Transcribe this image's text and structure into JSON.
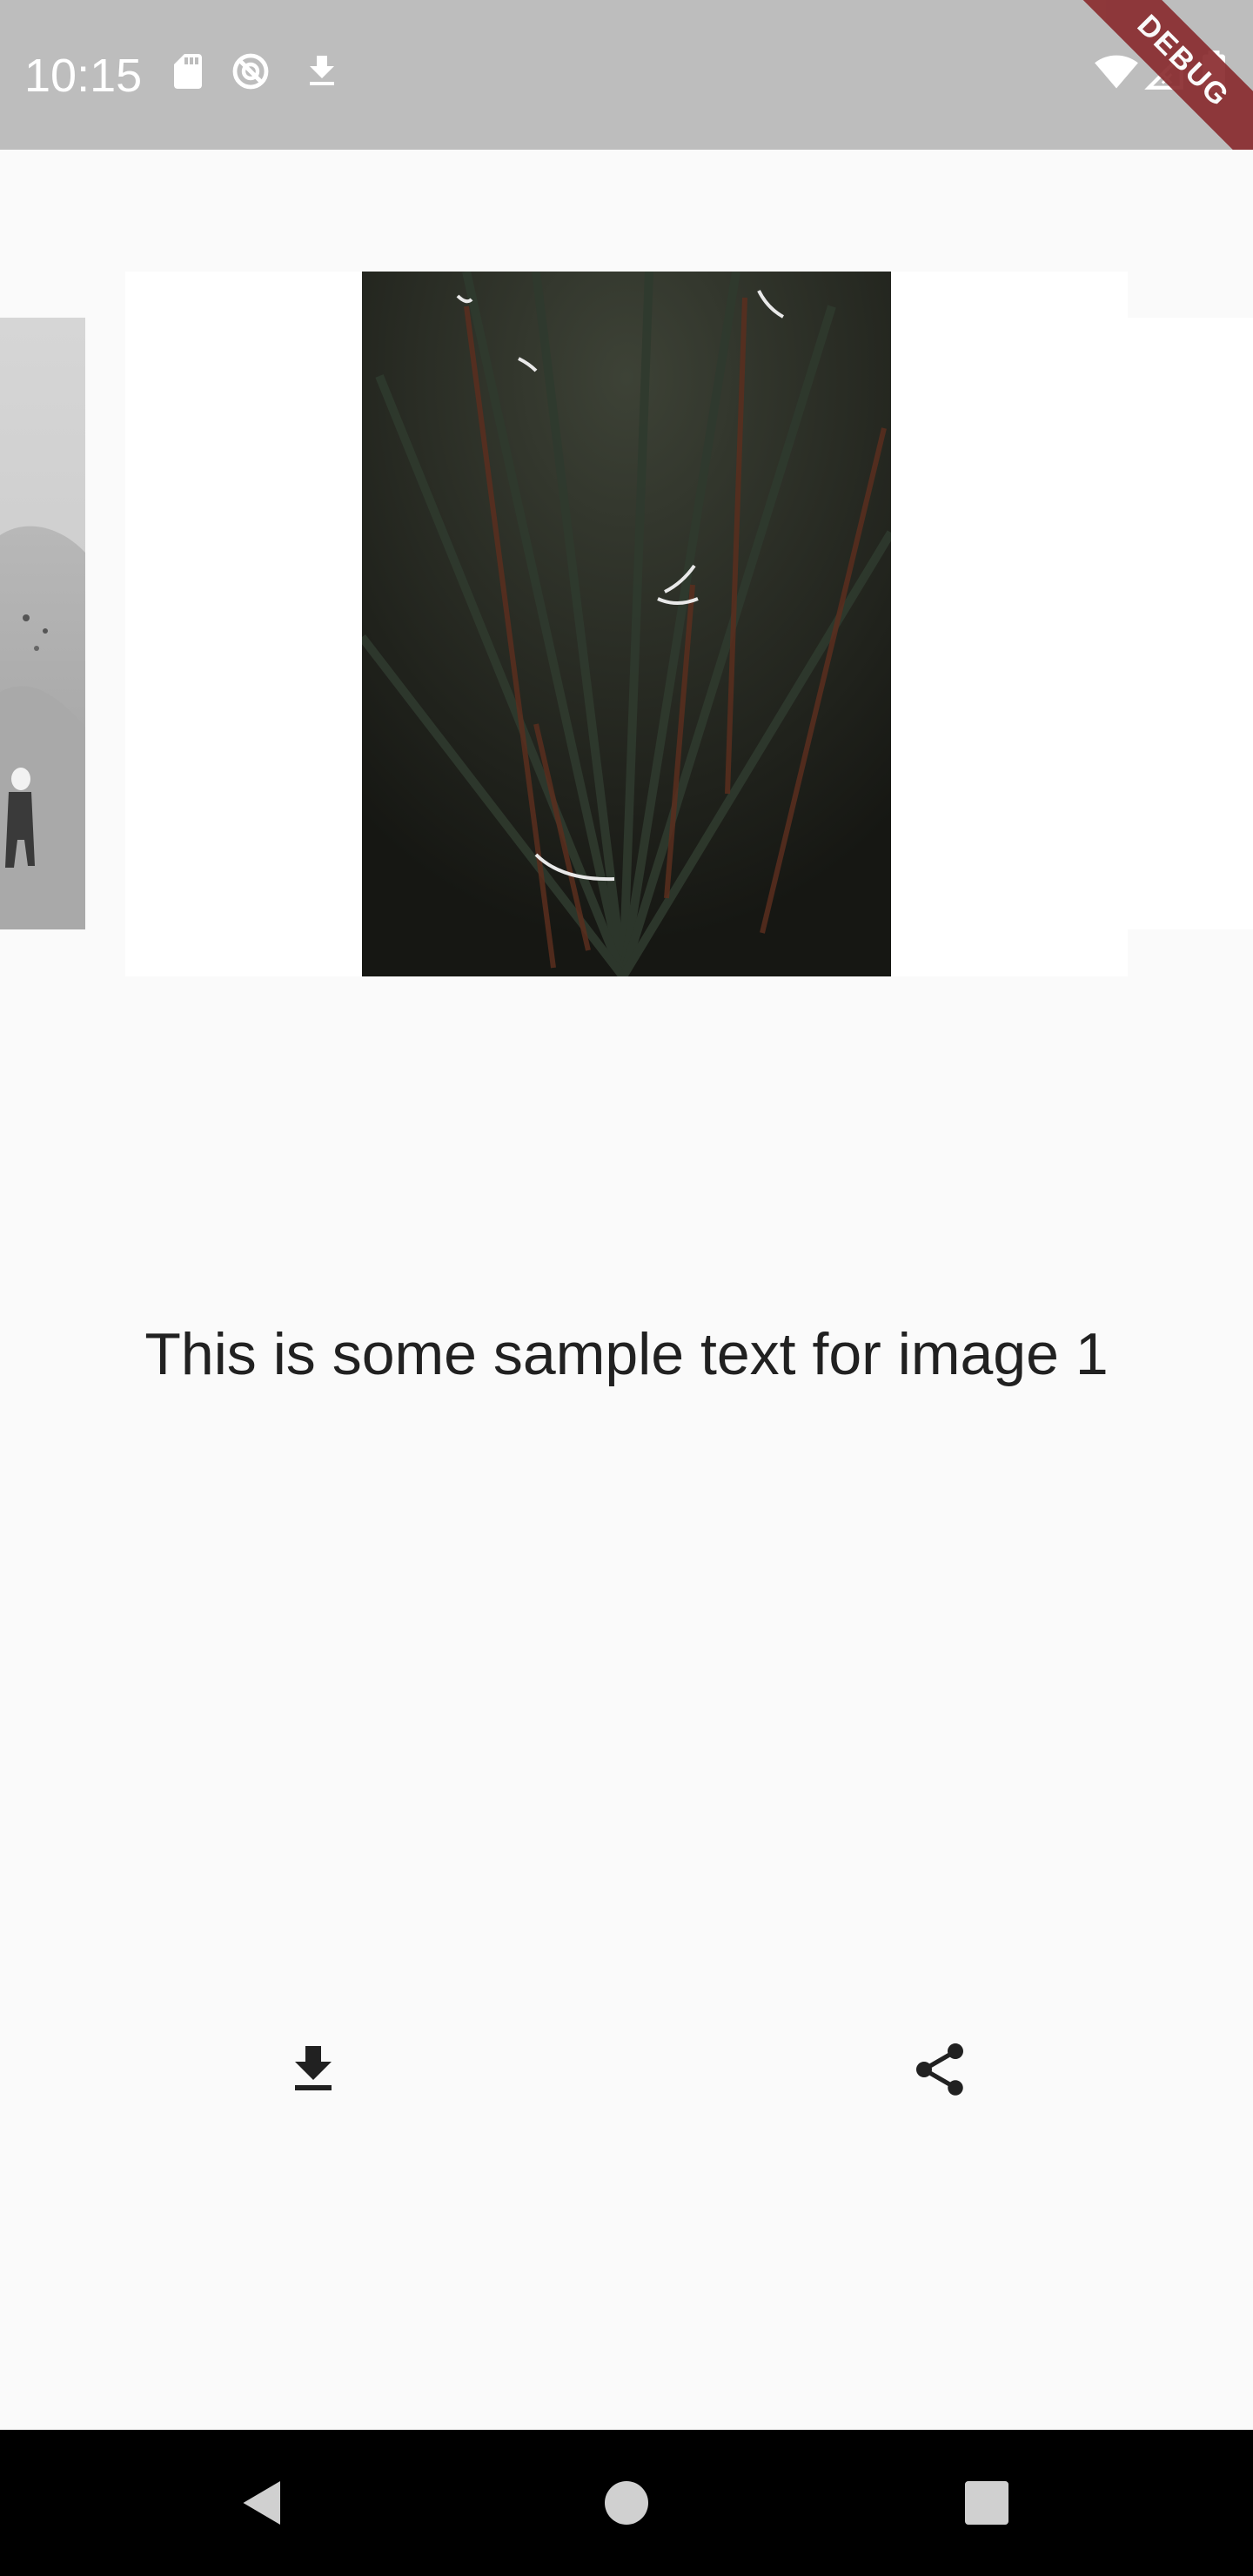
{
  "status_bar": {
    "time": "10:15",
    "icons": [
      "sd-card-icon",
      "sync-disabled-icon",
      "download-icon",
      "wifi-icon",
      "signal-icon",
      "battery-icon"
    ],
    "debug_banner": "DEBUG",
    "colors": {
      "background": "#bdbdbd",
      "banner": "#8a2c2f"
    }
  },
  "carousel": {
    "current_index": 1,
    "slides": [
      "desert-photo",
      "spiky-plant-photo",
      "next-photo"
    ]
  },
  "caption": "This is some sample text for image 1",
  "actions": {
    "download_icon": "download-icon",
    "share_icon": "share-icon"
  },
  "navigation": {
    "back_icon": "back-triangle-icon",
    "home_icon": "home-circle-icon",
    "recents_icon": "recents-square-icon"
  },
  "colors": {
    "page_background": "#fafafa",
    "text": "#212121",
    "nav_bar": "#000000"
  }
}
